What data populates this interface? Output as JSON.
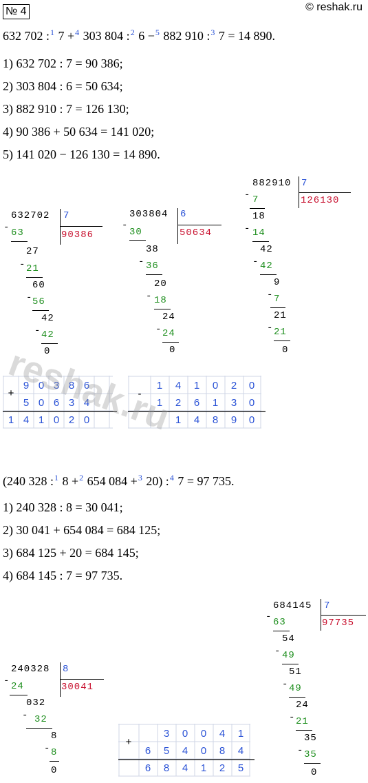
{
  "header": {
    "badge": "№ 4",
    "site": "© reshak.ru"
  },
  "task1": {
    "expr": {
      "a": "632 702 :",
      "s1": "1",
      "b": " 7 +",
      "s2": "4",
      "c": " 303 804 :",
      "s3": "2",
      "d": " 6 −",
      "s4": "5",
      "e": " 882 910 :",
      "s5": "3",
      "f": " 7 = 14 890."
    },
    "steps": [
      "1) 632 702 : 7 = 90 386;",
      "2) 303 804 : 6 = 50 634;",
      "3) 882 910 : 7 = 126 130;",
      "4) 90 386 + 50 634 = 141 020;",
      "5) 141 020 − 126 130 = 14 890."
    ]
  },
  "div1": {
    "dividend": "632702",
    "divisor": "7",
    "quotient": "90386",
    "rows": [
      "63",
      "27",
      "21",
      "60",
      "56",
      "42",
      "42",
      "0"
    ]
  },
  "div2": {
    "dividend": "303804",
    "divisor": "6",
    "quotient": "50634",
    "rows": [
      "30",
      "38",
      "36",
      "20",
      "18",
      "24",
      "24",
      "0"
    ]
  },
  "div3": {
    "dividend": "882910",
    "divisor": "7",
    "quotient": "126130",
    "rows": [
      "7",
      "18",
      "14",
      "42",
      "42",
      "9",
      "7",
      "21",
      "21",
      "0"
    ]
  },
  "add1": {
    "op": "+",
    "r1": [
      "9",
      "0",
      "3",
      "8",
      "6"
    ],
    "r2": [
      "5",
      "0",
      "6",
      "3",
      "4"
    ],
    "r3": [
      "1",
      "4",
      "1",
      "0",
      "2",
      "0"
    ]
  },
  "sub1": {
    "op": "-",
    "r1": [
      "1",
      "4",
      "1",
      "0",
      "2",
      "0"
    ],
    "r2": [
      "1",
      "2",
      "6",
      "1",
      "3",
      "0"
    ],
    "r3": [
      "1",
      "4",
      "8",
      "9",
      "0"
    ]
  },
  "watermark": "reshak.ru",
  "task2": {
    "expr": {
      "a": "(240 328 :",
      "s1": "1",
      "b": " 8 +",
      "s2": "2",
      "c": " 654 084 +",
      "s3": "3",
      "d": " 20) :",
      "s4": "4",
      "e": " 7 = 97 735."
    },
    "steps": [
      "1) 240 328 : 8 = 30 041;",
      "2) 30 041 + 654 084 = 684 125;",
      "3) 684 125 + 20 = 684 145;",
      "4) 684 145 : 7 = 97 735."
    ]
  },
  "div4": {
    "dividend": "240328",
    "divisor": "8",
    "quotient": "30041",
    "rows": [
      "24",
      "032",
      "32",
      "8",
      "8",
      "0"
    ]
  },
  "div5": {
    "dividend": "684145",
    "divisor": "7",
    "quotient": "97735",
    "rows": [
      "63",
      "54",
      "49",
      "51",
      "49",
      "24",
      "21",
      "35",
      "35",
      "0"
    ]
  },
  "add2": {
    "op": "+",
    "r1": [
      "3",
      "0",
      "0",
      "4",
      "1"
    ],
    "r2": [
      "6",
      "5",
      "4",
      "0",
      "8",
      "4"
    ],
    "r3": [
      "6",
      "8",
      "4",
      "1",
      "2",
      "5"
    ]
  }
}
